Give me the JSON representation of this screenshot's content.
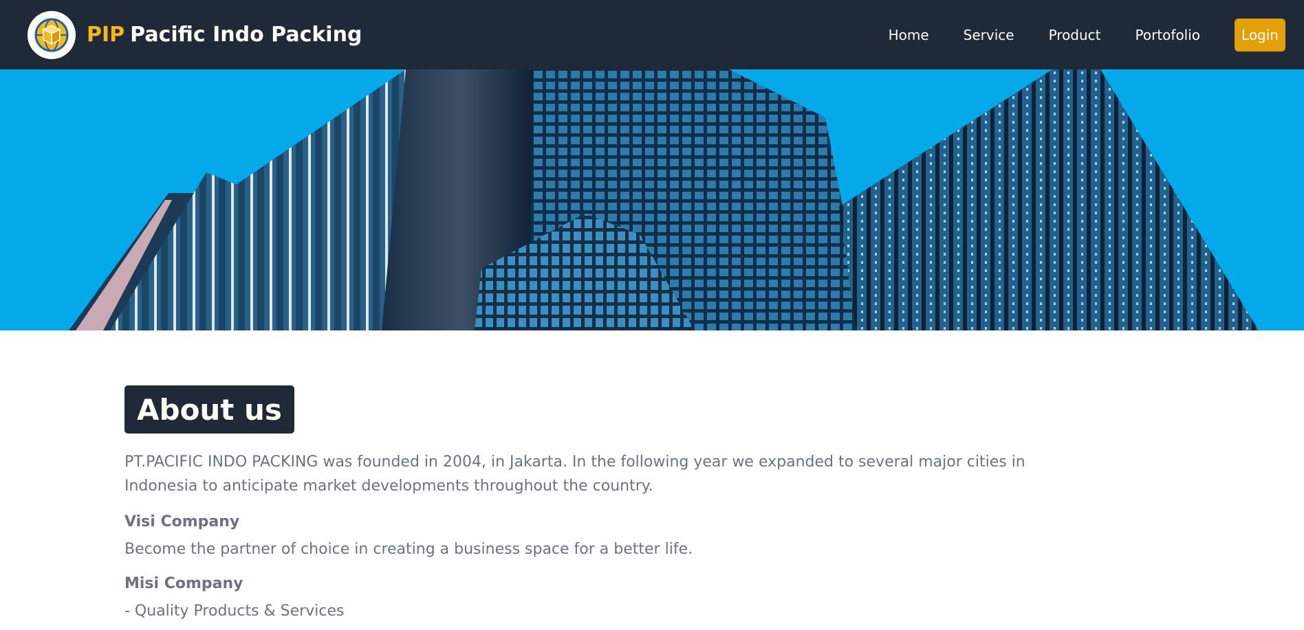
{
  "header": {
    "logo_icon": "box-globe-icon",
    "brand_abbr": "PIP",
    "brand_name": "Pacific Indo Packing",
    "nav": [
      {
        "label": "Home"
      },
      {
        "label": "Service"
      },
      {
        "label": "Product"
      },
      {
        "label": "Portofolio"
      }
    ],
    "login_label": "Login",
    "colors": {
      "navbar": "#1f2937",
      "accent": "#f5b818",
      "login_bg": "#e3a008"
    }
  },
  "hero": {
    "image": "skyscrapers-photo",
    "sky_color": "#04a9ea"
  },
  "about": {
    "title": "About us",
    "intro": "PT.PACIFIC INDO PACKING was founded in 2004, in Jakarta. In the following year we expanded to several major cities in Indonesia to anticipate market developments throughout the country.",
    "visi_heading": "Visi Company",
    "visi_text": "Become the partner of choice in creating a business space for a better life.",
    "misi_heading": "Misi Company",
    "misi_items": [
      "- Quality Products & Services"
    ]
  }
}
